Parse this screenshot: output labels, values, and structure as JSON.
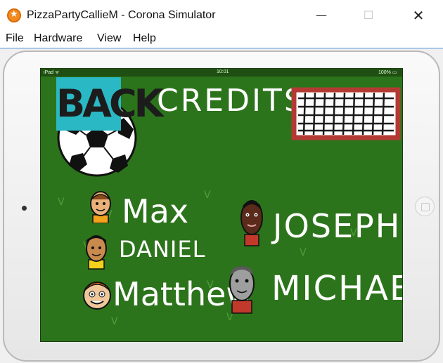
{
  "window": {
    "title": "PizzaPartyCallieM - Corona Simulator",
    "minimize_glyph": "—",
    "maximize_glyph": "☐",
    "close_glyph": "✕"
  },
  "menu": [
    "File",
    "Hardware",
    "View",
    "Help"
  ],
  "device": {
    "status_left": "iPad ᯤ",
    "status_time": "10:01",
    "status_battery": "100% ▭"
  },
  "screen": {
    "back_label": "BACK",
    "title": "CREDITS",
    "credits": {
      "max": "Max",
      "daniel": "DANIEL",
      "matthew": "Matthew",
      "joseph": "JOSEPH",
      "michael": "MICHAEL"
    }
  },
  "colors": {
    "field_green": "#2c741b",
    "sign_cyan": "#2ab8c4",
    "goal_frame_red": "#b33a33",
    "app_icon_orange": "#f28a1e"
  },
  "icons": [
    "app-icon",
    "soccer-ball-icon",
    "goal-net-icon",
    "player-face-icon"
  ]
}
